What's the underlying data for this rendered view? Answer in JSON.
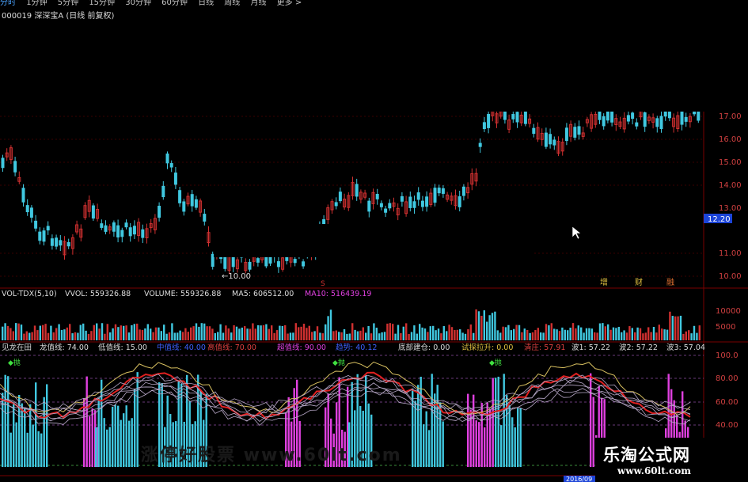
{
  "tabs": [
    "分时",
    "1分钟",
    "5分钟",
    "15分钟",
    "30分钟",
    "60分钟",
    "日线",
    "周线",
    "月线",
    "更多 >"
  ],
  "stock": {
    "title": "000019 深深宝A (日线 前复权)"
  },
  "price_axis": {
    "ticks": [
      "17.00",
      "16.00",
      "15.00",
      "14.00",
      "13.00",
      "12.20",
      "11.00",
      "10.00"
    ],
    "current": "12.20",
    "low_label": "←10.00",
    "marker_s": "S"
  },
  "badges": [
    "增",
    "财",
    "融"
  ],
  "volume": {
    "title": "VOL-TDX(5,10)",
    "vvol_label": "VVOL: 559326.88",
    "volume_label": "VOLUME: 559326.88",
    "ma5_label": "MA5: 606512.00",
    "ma10_label": "MA10: 516439.19",
    "axis_label": "10000",
    "right_label": "5000"
  },
  "indicator": {
    "title": "见龙在田",
    "items": [
      "龙值线: 74.00",
      "低值线: 15.00",
      "中值线: 40.00",
      "高值线: 70.00",
      "超值线: 90.00",
      "趋势: 40.12",
      "底部建仓: 0.00",
      "试探拉升: 0.00",
      "清庄: 57.91",
      "波1: 57.22",
      "波2: 57.22",
      "波3: 57.04"
    ],
    "axis": [
      "100.0",
      "80.00",
      "60.00",
      "40.00"
    ],
    "tags": [
      "◆抛",
      "◆抛",
      "◆抛"
    ]
  },
  "date_axis": {
    "last": "2016/09"
  },
  "watermark": "涨停好股票 www.60lt.com",
  "logo": {
    "name": "乐淘公式网",
    "url": "www.60lt.com"
  },
  "colors": {
    "up": "#d03030",
    "down": "#40c8e0",
    "magenta": "#e040e0",
    "yellow": "#d8c060",
    "grid": "#7a0000",
    "axis_text": "#d04040"
  }
}
